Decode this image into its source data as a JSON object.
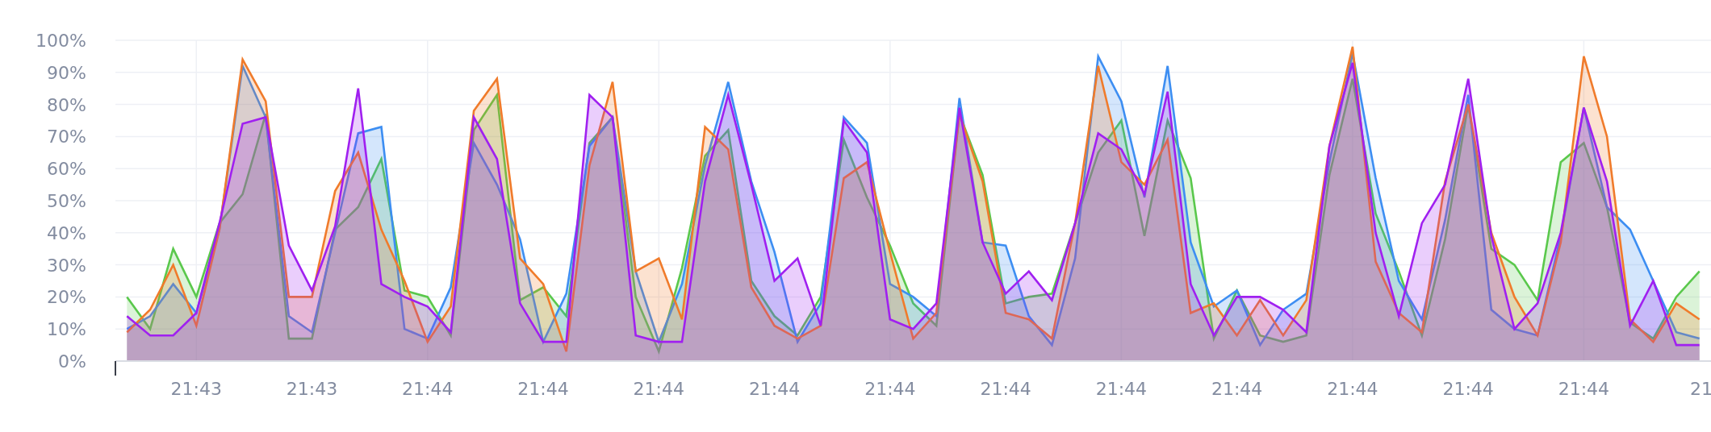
{
  "chart_data": {
    "type": "area",
    "grid": true,
    "categories": [
      null,
      null,
      null,
      "21:43",
      null,
      null,
      null,
      null,
      "21:43",
      null,
      null,
      null,
      null,
      "21:44",
      null,
      null,
      null,
      null,
      "21:44",
      null,
      null,
      null,
      null,
      "21:44",
      null,
      null,
      null,
      null,
      "21:44",
      null,
      null,
      null,
      null,
      "21:44",
      null,
      null,
      null,
      null,
      "21:44",
      null,
      null,
      null,
      null,
      "21:44",
      null,
      null,
      null,
      null,
      "21:44",
      null,
      null,
      null,
      null,
      "21:44",
      null,
      null,
      null,
      null,
      "21:44",
      null,
      null,
      null,
      null,
      "21:44",
      null,
      null,
      null,
      null,
      "21"
    ],
    "series": [
      {
        "color": "#5ac84c",
        "values": [
          20,
          10,
          35,
          20,
          43,
          52,
          77,
          7,
          7,
          41,
          48,
          63,
          22,
          20,
          8,
          72,
          83,
          19,
          23,
          14,
          68,
          76,
          20,
          3,
          29,
          64,
          72,
          25,
          14,
          8,
          20,
          69,
          51,
          36,
          18,
          11,
          77,
          58,
          18,
          20,
          21,
          43,
          65,
          75,
          39,
          75,
          57,
          7,
          22,
          8,
          6,
          8,
          58,
          88,
          46,
          28,
          8,
          38,
          80,
          35,
          30,
          19,
          62,
          68,
          48,
          12,
          7,
          20,
          28
        ]
      },
      {
        "color": "#3d8ef2",
        "values": [
          10,
          14,
          24,
          15,
          41,
          92,
          76,
          14,
          9,
          40,
          71,
          73,
          10,
          7,
          23,
          68,
          55,
          38,
          6,
          21,
          67,
          76,
          28,
          6,
          24,
          61,
          87,
          56,
          34,
          6,
          18,
          76,
          68,
          24,
          20,
          14,
          82,
          37,
          36,
          14,
          5,
          32,
          95,
          81,
          51,
          92,
          37,
          17,
          22,
          5,
          16,
          21,
          62,
          96,
          57,
          25,
          13,
          44,
          83,
          16,
          10,
          8,
          39,
          79,
          48,
          41,
          25,
          9,
          7
        ]
      },
      {
        "color": "#f07b2b",
        "values": [
          9,
          16,
          30,
          11,
          41,
          94,
          81,
          20,
          20,
          53,
          65,
          41,
          25,
          6,
          17,
          78,
          88,
          32,
          24,
          3,
          61,
          87,
          28,
          32,
          13,
          73,
          66,
          23,
          11,
          7,
          11,
          57,
          62,
          34,
          7,
          15,
          77,
          56,
          15,
          13,
          7,
          43,
          92,
          62,
          55,
          69,
          15,
          18,
          8,
          19,
          8,
          19,
          67,
          98,
          31,
          15,
          9,
          56,
          80,
          40,
          20,
          8,
          37,
          95,
          70,
          13,
          6,
          18,
          13
        ]
      },
      {
        "color": "#a020f0",
        "values": [
          14,
          8,
          8,
          15,
          43,
          74,
          76,
          36,
          22,
          42,
          85,
          24,
          20,
          17,
          9,
          76,
          63,
          18,
          6,
          6,
          83,
          76,
          8,
          6,
          6,
          56,
          83,
          55,
          25,
          32,
          11,
          75,
          65,
          13,
          10,
          18,
          79,
          37,
          21,
          28,
          19,
          43,
          71,
          66,
          52,
          84,
          24,
          8,
          20,
          20,
          16,
          9,
          67,
          93,
          40,
          14,
          43,
          55,
          88,
          39,
          10,
          18,
          40,
          79,
          56,
          11,
          25,
          5,
          5
        ]
      }
    ],
    "ylim": [
      0,
      100
    ],
    "yticks": [
      {
        "value": 0,
        "label": "0%"
      },
      {
        "value": 10,
        "label": "10%"
      },
      {
        "value": 20,
        "label": "20%"
      },
      {
        "value": 30,
        "label": "30%"
      },
      {
        "value": 40,
        "label": "40%"
      },
      {
        "value": 50,
        "label": "50%"
      },
      {
        "value": 60,
        "label": "60%"
      },
      {
        "value": 70,
        "label": "70%"
      },
      {
        "value": 80,
        "label": "80%"
      },
      {
        "value": 90,
        "label": "90%"
      },
      {
        "value": 100,
        "label": "100%"
      }
    ]
  }
}
